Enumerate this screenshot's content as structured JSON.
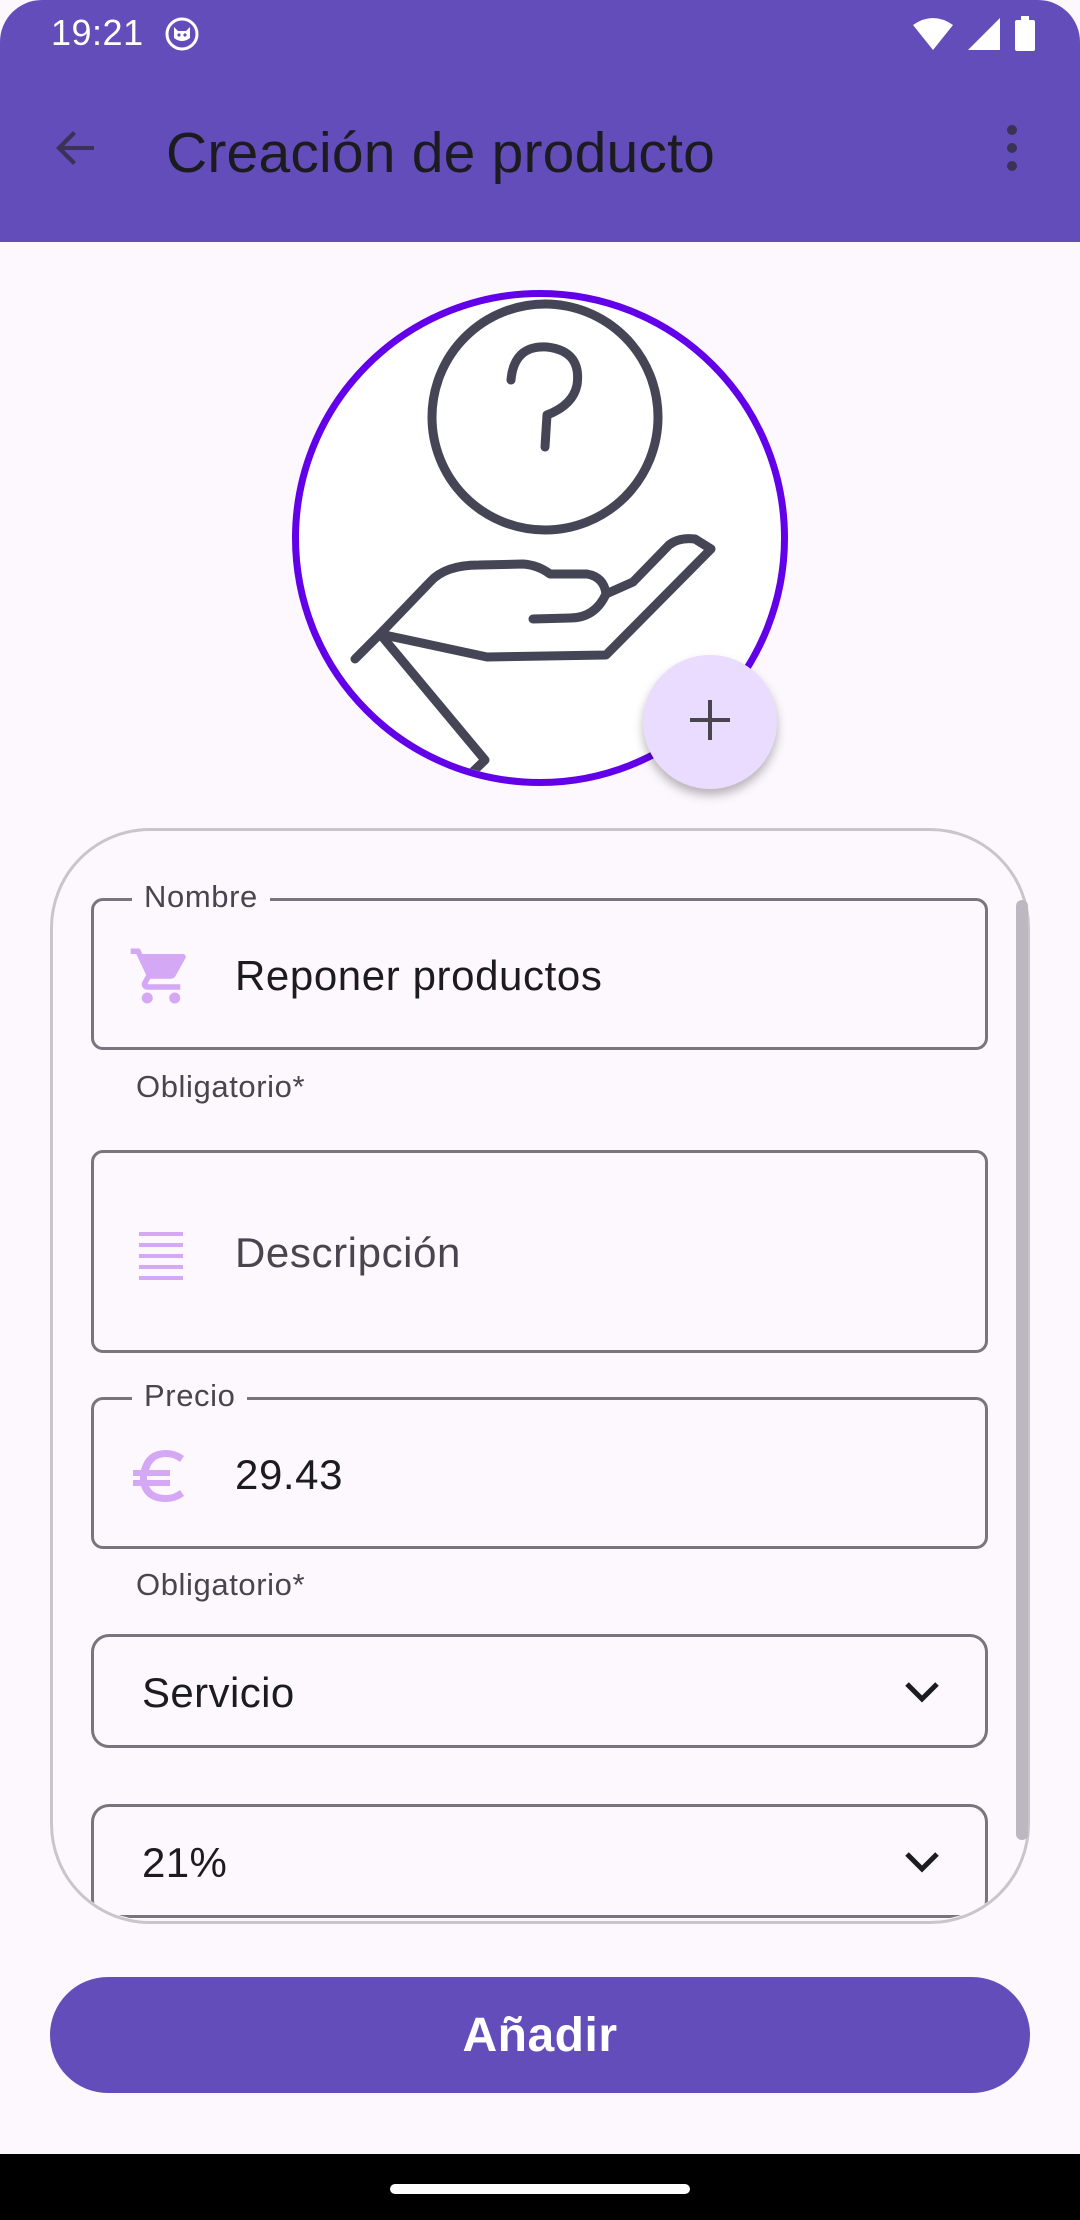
{
  "status_bar": {
    "time": "19:21",
    "icons": [
      "cat-app-icon",
      "wifi-icon",
      "signal-icon",
      "battery-icon"
    ]
  },
  "app_bar": {
    "title": "Creación de producto",
    "back_icon": "arrow-back-icon",
    "menu_icon": "more-vert-icon"
  },
  "product_image": {
    "icon": "hand-question-icon",
    "add_icon": "plus-icon"
  },
  "form": {
    "name": {
      "label": "Nombre",
      "value": "Reponer productos",
      "helper": "Obligatorio*",
      "icon": "shopping-cart-icon"
    },
    "description": {
      "placeholder": "Descripción",
      "value": "",
      "icon": "notes-icon"
    },
    "price": {
      "label": "Precio",
      "value": "29.43",
      "helper": "Obligatorio*",
      "icon": "euro-icon"
    },
    "type_select": {
      "value": "Servicio",
      "icon": "chevron-down-icon"
    },
    "tax_select": {
      "value": "21%",
      "icon": "chevron-down-icon"
    }
  },
  "actions": {
    "add_label": "Añadir"
  },
  "colors": {
    "primary": "#634dbb",
    "image_border": "#6200ea",
    "fab_background": "#eadcff",
    "field_icon": "#d4a8f5",
    "background": "#fdf7fe"
  }
}
